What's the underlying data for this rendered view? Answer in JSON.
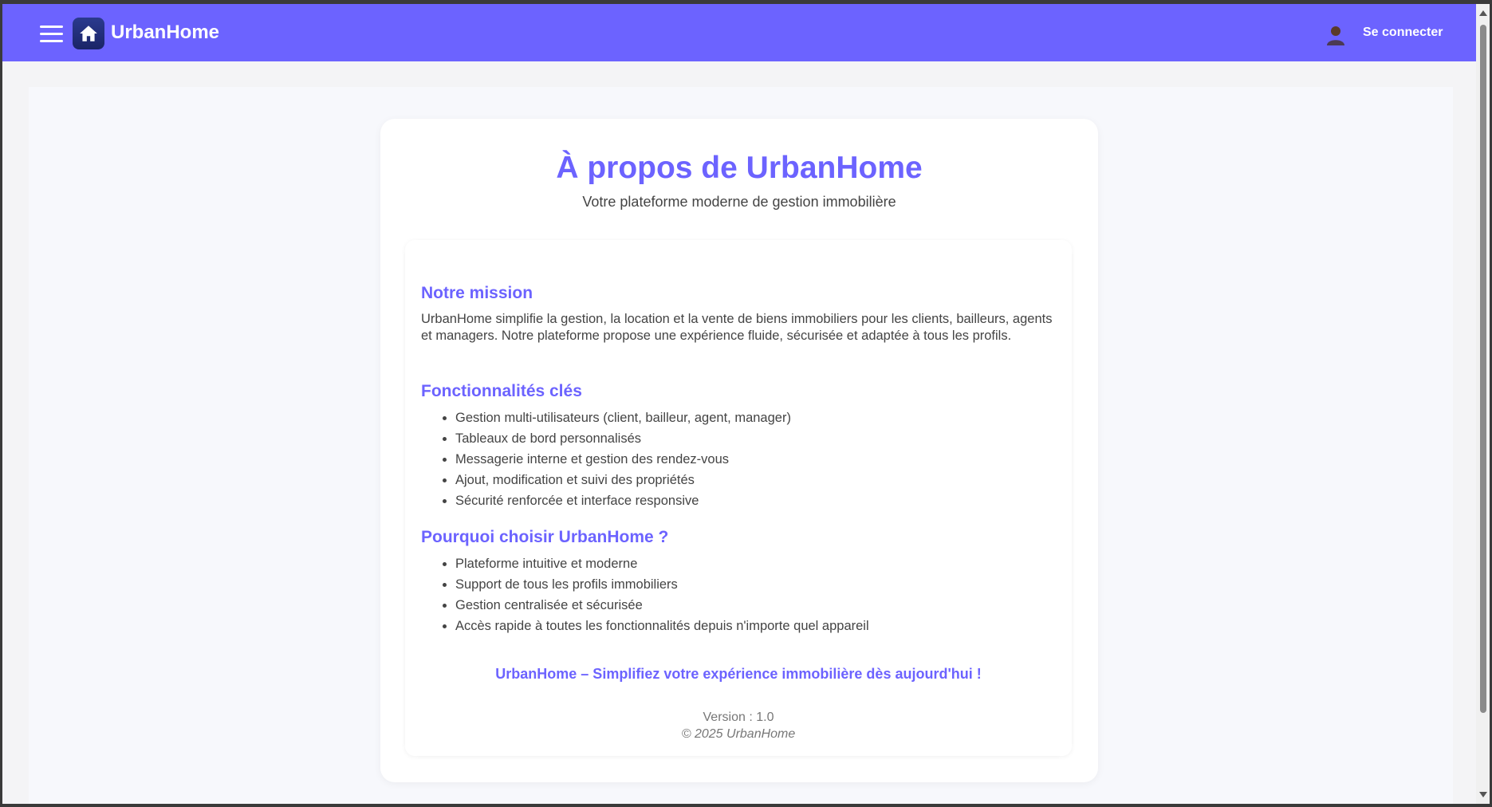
{
  "header": {
    "brand": "UrbanHome",
    "login_label": "Se connecter",
    "menu_icon": "hamburger-menu-icon",
    "logo_icon": "home-icon",
    "user_icon": "user-icon"
  },
  "page": {
    "title": "À propos de UrbanHome",
    "subtitle": "Votre plateforme moderne de gestion immobilière"
  },
  "mission": {
    "heading": "Notre mission",
    "text": "UrbanHome simplifie la gestion, la location et la vente de biens immobiliers pour les clients, bailleurs, agents et managers. Notre plateforme propose une expérience fluide, sécurisée et adaptée à tous les profils."
  },
  "features": {
    "heading": "Fonctionnalités clés",
    "items": [
      "Gestion multi-utilisateurs (client, bailleur, agent, manager)",
      "Tableaux de bord personnalisés",
      "Messagerie interne et gestion des rendez-vous",
      "Ajout, modification et suivi des propriétés",
      "Sécurité renforcée et interface responsive"
    ]
  },
  "why": {
    "heading": "Pourquoi choisir UrbanHome ?",
    "items": [
      "Plateforme intuitive et moderne",
      "Support de tous les profils immobiliers",
      "Gestion centralisée et sécurisée",
      "Accès rapide à toutes les fonctionnalités depuis n'importe quel appareil"
    ]
  },
  "footer": {
    "slogan": "UrbanHome – Simplifiez votre expérience immobilière dès aujourd'hui !",
    "version": "Version : 1.0",
    "copyright": "© 2025 UrbanHome"
  },
  "colors": {
    "accent": "#6c63ff",
    "logo_bg": "#1f2a78",
    "text": "#444444"
  }
}
